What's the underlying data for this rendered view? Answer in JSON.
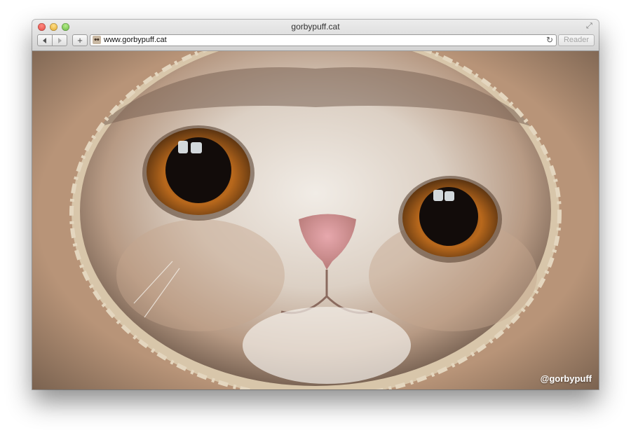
{
  "window": {
    "title": "gorbypuff.cat",
    "traffic_lights": [
      "close",
      "minimize",
      "zoom"
    ]
  },
  "toolbar": {
    "back_icon": "back-arrow-icon",
    "forward_icon": "forward-arrow-icon",
    "add_icon": "plus-icon",
    "url": "www.gorbypuff.cat",
    "reload_icon": "reload-icon",
    "reader_label": "Reader"
  },
  "content": {
    "image_subject": "cat face peeking through cardboard hole",
    "watermark": "@gorbypuff"
  },
  "colors": {
    "cardboard": "#b89478",
    "eye_iris": "#b86a1c"
  }
}
